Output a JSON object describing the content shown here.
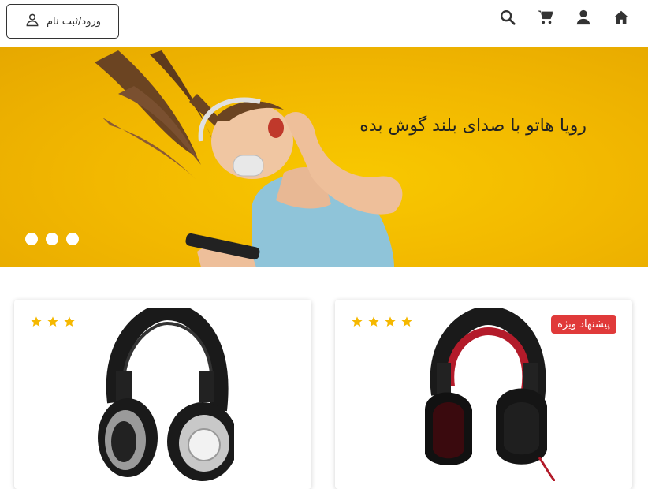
{
  "header": {
    "login_label": "ورود/ثبت نام",
    "icons": [
      "home-icon",
      "user-icon",
      "cart-icon",
      "search-icon"
    ]
  },
  "hero": {
    "title": "رویا هاتو با صدای بلند گوش بده",
    "slides": 3,
    "background_color": "#f4bc00"
  },
  "products": [
    {
      "rating": 3,
      "badge": ""
    },
    {
      "rating": 4,
      "badge": "پیشنهاد ویژه"
    }
  ],
  "colors": {
    "star": "#f5b800",
    "badge": "#e03a3a",
    "text": "#333333"
  }
}
